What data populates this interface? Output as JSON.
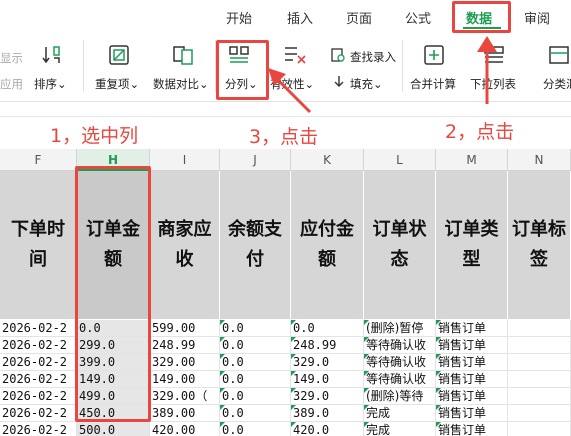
{
  "menu": {
    "tabs": [
      {
        "label": "开始",
        "active": false
      },
      {
        "label": "插入",
        "active": false
      },
      {
        "label": "页面",
        "active": false
      },
      {
        "label": "公式",
        "active": false
      },
      {
        "label": "数据",
        "active": true
      },
      {
        "label": "审阅",
        "active": false
      }
    ]
  },
  "ribbon": {
    "show_partial": "显示",
    "apply_partial": "应用",
    "sort_label": "排序",
    "duplicates_label": "重复项",
    "compare_label": "数据对比",
    "split_label": "分列",
    "validity_label": "有效性",
    "find_entry_label": "查找录入",
    "fill_label": "填充",
    "merge_calc_label": "合并计算",
    "dropdown_list_label": "下拉列表",
    "subtotal_label": "分类汇",
    "dropdown_arrow": "⌄"
  },
  "annotations": {
    "step1": "1，选中列",
    "step2": "2，点击",
    "step3": "3，点击"
  },
  "columns": [
    "F",
    "H",
    "I",
    "J",
    "K",
    "L",
    "M",
    "N"
  ],
  "selected_column": "H",
  "headers": [
    "下单时间",
    "订单金额",
    "商家应收",
    "余额支付",
    "应付金额",
    "订单状态",
    "订单类型",
    "订单标签"
  ],
  "rows": [
    {
      "F": "2026-02-2",
      "H": "0.0",
      "I": "599.00",
      "J": "0.0",
      "K": "0.0",
      "L": "(删除)暂停",
      "M": "销售订单"
    },
    {
      "F": "2026-02-2",
      "H": "299.0",
      "I": "248.99",
      "J": "0.0",
      "K": "248.99",
      "L": "等待确认收",
      "M": "销售订单"
    },
    {
      "F": "2026-02-2",
      "H": "399.0",
      "I": "329.00",
      "J": "0.0",
      "K": "329.0",
      "L": "等待确认收",
      "M": "销售订单"
    },
    {
      "F": "2026-02-2",
      "H": "149.0",
      "I": "149.00",
      "J": "0.0",
      "K": "149.0",
      "L": "等待确认收",
      "M": "销售订单"
    },
    {
      "F": "2026-02-2",
      "H": "499.0",
      "I": "329.00（",
      "J": "0.0",
      "K": "329.0",
      "L": "(删除)等待",
      "M": "销售订单"
    },
    {
      "F": "2026-02-2",
      "H": "450.0",
      "I": "389.00",
      "J": "0.0",
      "K": "389.0",
      "L": "完成",
      "M": "销售订单"
    },
    {
      "F": "2026-02-2",
      "H": "500.0",
      "I": "420.00",
      "J": "0.0",
      "K": "420.0",
      "L": "完成",
      "M": "销售订单"
    }
  ],
  "colors": {
    "accent_green": "#1f9d55",
    "annotation_red": "#e8473f",
    "header_fill": "#d6d6d6"
  }
}
